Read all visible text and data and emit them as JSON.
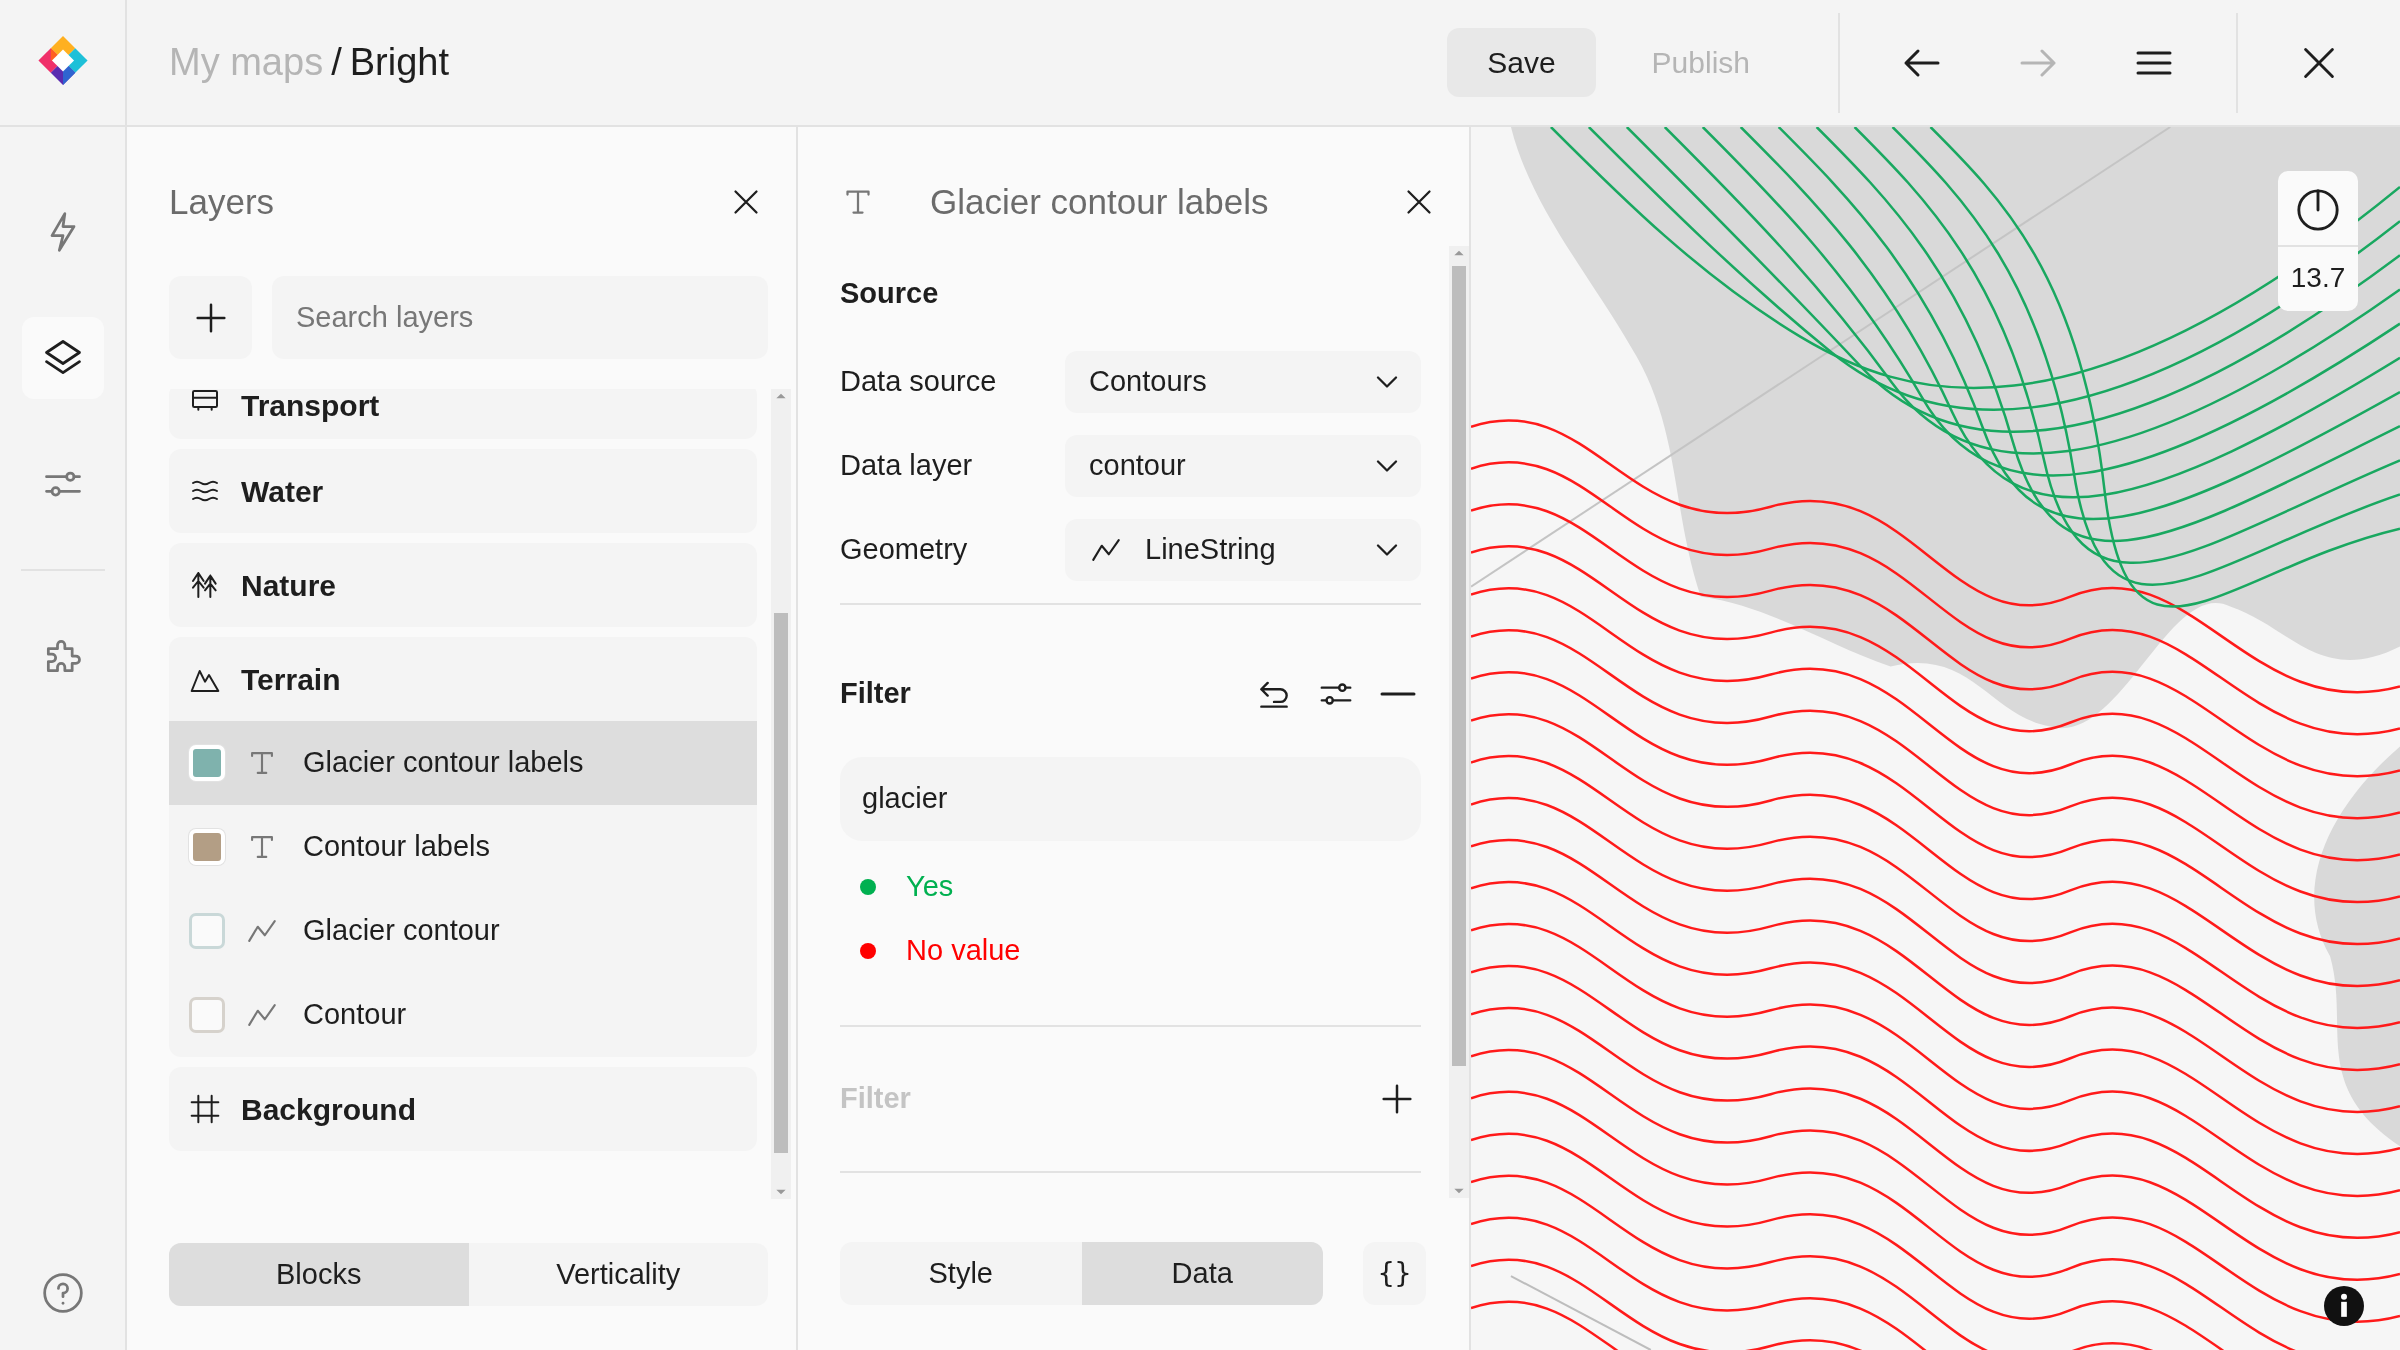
{
  "header": {
    "breadcrumb": {
      "parent": "My maps",
      "separator": "/",
      "current": "Bright"
    },
    "actions": [
      {
        "label": "Save",
        "disabled": false
      },
      {
        "label": "Publish",
        "disabled": true
      }
    ],
    "history": [
      {
        "kind": "undo",
        "disabled": false
      },
      {
        "kind": "redo",
        "disabled": true
      }
    ]
  },
  "rail": {
    "items": [
      {
        "kind": "actions",
        "selected": false
      },
      {
        "kind": "layers",
        "selected": true
      },
      {
        "kind": "settings",
        "selected": false
      },
      {
        "kind": "plugins",
        "selected": false
      }
    ]
  },
  "layers_panel": {
    "title": "Layers",
    "search": {
      "placeholder": "Search layers"
    },
    "groups": [
      {
        "name": "Transport",
        "kind": "transport"
      },
      {
        "name": "Water",
        "kind": "water"
      },
      {
        "name": "Nature",
        "kind": "nature"
      },
      {
        "name": "Terrain",
        "kind": "terrain",
        "children": [
          {
            "name": "Glacier contour labels",
            "kind": "symbol",
            "visible": true,
            "color": "#7fb2ad",
            "selected": true
          },
          {
            "name": "Contour labels",
            "kind": "symbol",
            "visible": true,
            "color": "#b39e85",
            "selected": false
          },
          {
            "name": "Glacier contour",
            "kind": "line",
            "visible": false,
            "color": "#c9d8d8",
            "selected": false
          },
          {
            "name": "Contour",
            "kind": "line",
            "visible": false,
            "color": "#d6d2cc",
            "selected": false
          }
        ]
      },
      {
        "name": "Background",
        "kind": "background"
      }
    ],
    "view_tabs": [
      {
        "label": "Blocks",
        "selected": true
      },
      {
        "label": "Verticality",
        "selected": false
      }
    ]
  },
  "editor": {
    "title": "Glacier contour labels",
    "kind": "symbol",
    "source": {
      "title": "Source",
      "fields": [
        {
          "label": "Data source",
          "value": "Contours",
          "kind": "plain"
        },
        {
          "label": "Data layer",
          "value": "contour",
          "kind": "plain"
        },
        {
          "label": "Geometry",
          "value": "LineString",
          "kind": "line"
        }
      ]
    },
    "filters": [
      {
        "title": "Filter",
        "disabled": false,
        "expression": "glacier",
        "results": [
          {
            "label": "Yes",
            "color": "#00b050"
          },
          {
            "label": "No value",
            "color": "#ff0000"
          }
        ]
      },
      {
        "title": "Filter",
        "disabled": true
      }
    ],
    "tabs": [
      {
        "label": "Style",
        "selected": false
      },
      {
        "label": "Data",
        "selected": true
      }
    ],
    "code_button": "{}"
  },
  "map": {
    "zoom": "13.7"
  }
}
